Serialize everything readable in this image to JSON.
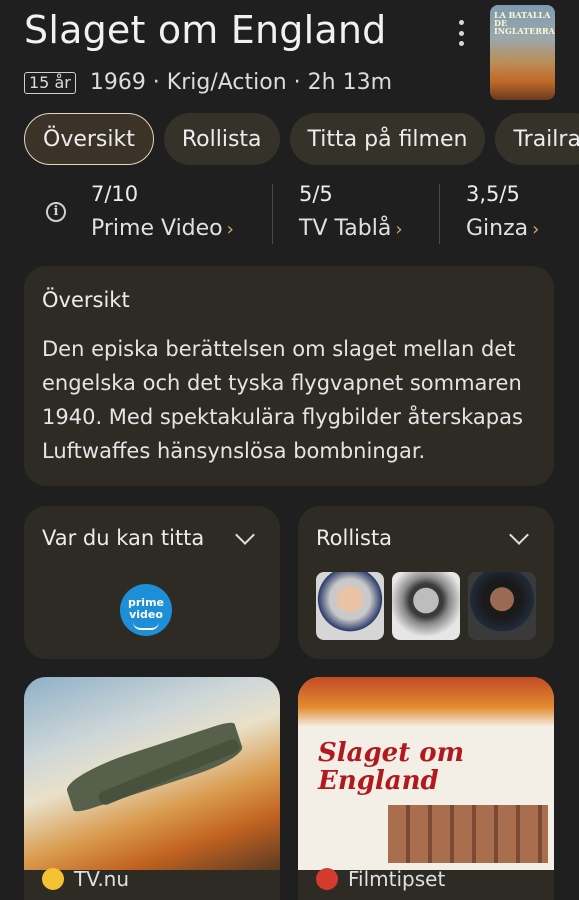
{
  "title": "Slaget om England",
  "poster_thumb_text": "LA BATALLA DE INGLATERRA",
  "meta": {
    "age": "15 år",
    "info": "1969 · Krig/Action · 2h 13m"
  },
  "tabs": [
    "Översikt",
    "Rollista",
    "Titta på filmen",
    "Trailra"
  ],
  "ratings": [
    {
      "score": "7/10",
      "source": "Prime Video"
    },
    {
      "score": "5/5",
      "source": "TV Tablå"
    },
    {
      "score": "3,5/5",
      "source": "Ginza"
    }
  ],
  "overview": {
    "heading": "Översikt",
    "text": "Den episka berättelsen om slaget mellan det engelska och det tyska flygvapnet sommaren 1940. Med spektakulära flygbilder återskapas Luftwaffes hänsynslösa bombningar."
  },
  "where_to_watch": {
    "heading": "Var du kan titta",
    "provider": "prime video"
  },
  "cast": {
    "heading": "Rollista"
  },
  "images": [
    {
      "source": "TV.nu",
      "color": "#f2c230"
    },
    {
      "source": "Filmtipset",
      "color": "#d23b2e",
      "poster_title": "Slaget om England"
    }
  ],
  "colors": {
    "background": "#1f1f1f",
    "card": "#2e2b25",
    "accent": "#d7a86e"
  }
}
